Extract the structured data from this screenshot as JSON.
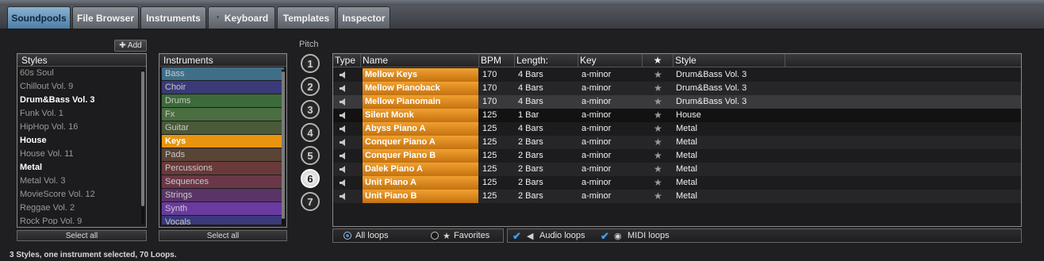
{
  "tabs": [
    {
      "label": "Soundpools",
      "active": true
    },
    {
      "label": "File Browser",
      "active": false
    },
    {
      "label": "Instruments",
      "active": false
    },
    {
      "label": "Keyboard",
      "active": false
    },
    {
      "label": "Templates",
      "active": false
    },
    {
      "label": "Inspector",
      "active": false
    }
  ],
  "add_button": {
    "icon": "plus-icon",
    "label": "Add"
  },
  "styles": {
    "header": "Styles",
    "items": [
      {
        "label": "60s Soul",
        "selected": false
      },
      {
        "label": "Chillout Vol. 9",
        "selected": false
      },
      {
        "label": "Drum&Bass Vol. 3",
        "selected": true
      },
      {
        "label": "Funk Vol. 1",
        "selected": false
      },
      {
        "label": "HipHop Vol. 16",
        "selected": false
      },
      {
        "label": "House",
        "selected": true
      },
      {
        "label": "House Vol. 11",
        "selected": false
      },
      {
        "label": "Metal",
        "selected": true
      },
      {
        "label": "Metal Vol. 3",
        "selected": false
      },
      {
        "label": "MovieScore Vol. 12",
        "selected": false
      },
      {
        "label": "Reggae Vol. 2",
        "selected": false
      },
      {
        "label": "Rock Pop Vol. 9",
        "selected": false
      }
    ],
    "select_all": "Select all"
  },
  "instruments": {
    "header": "Instruments",
    "items": [
      {
        "label": "Bass",
        "color": "#3f6f88",
        "selected": false
      },
      {
        "label": "Choir",
        "color": "#3a3a78",
        "selected": false
      },
      {
        "label": "Drums",
        "color": "#3c6a3a",
        "selected": false
      },
      {
        "label": "Fx",
        "color": "#4a6e40",
        "selected": false
      },
      {
        "label": "Guitar",
        "color": "#4a5a38",
        "selected": false
      },
      {
        "label": "Keys",
        "color": "#e8940e",
        "selected": true
      },
      {
        "label": "Pads",
        "color": "#5a4436",
        "selected": false
      },
      {
        "label": "Percussions",
        "color": "#6a3a3a",
        "selected": false
      },
      {
        "label": "Sequences",
        "color": "#6a3848",
        "selected": false
      },
      {
        "label": "Strings",
        "color": "#5a3466",
        "selected": false
      },
      {
        "label": "Synth",
        "color": "#6a3aa0",
        "selected": false
      },
      {
        "label": "Vocals",
        "color": "#3a3a7a",
        "selected": false
      }
    ],
    "select_all": "Select all"
  },
  "pitch": {
    "title": "Pitch",
    "buttons": [
      "1",
      "2",
      "3",
      "4",
      "5",
      "6",
      "7"
    ],
    "selected": "6"
  },
  "loops": {
    "columns": {
      "type": "Type",
      "name": "Name",
      "bpm": "BPM",
      "length": "Length:",
      "key": "Key",
      "star": "★",
      "style": "Style"
    },
    "rows": [
      {
        "name": "Mellow Keys",
        "bpm": "170",
        "length": "4 Bars",
        "key": "a-minor",
        "style": "Drum&Bass Vol. 3"
      },
      {
        "name": "Mellow Pianoback",
        "bpm": "170",
        "length": "4 Bars",
        "key": "a-minor",
        "style": "Drum&Bass Vol. 3"
      },
      {
        "name": "Mellow Pianomain",
        "bpm": "170",
        "length": "4 Bars",
        "key": "a-minor",
        "style": "Drum&Bass Vol. 3"
      },
      {
        "name": "Silent Monk",
        "bpm": "125",
        "length": "1 Bar",
        "key": "a-minor",
        "style": "House"
      },
      {
        "name": "Abyss Piano A",
        "bpm": "125",
        "length": "4 Bars",
        "key": "a-minor",
        "style": "Metal"
      },
      {
        "name": "Conquer Piano A",
        "bpm": "125",
        "length": "2 Bars",
        "key": "a-minor",
        "style": "Metal"
      },
      {
        "name": "Conquer Piano B",
        "bpm": "125",
        "length": "2 Bars",
        "key": "a-minor",
        "style": "Metal"
      },
      {
        "name": "Dalek Piano A",
        "bpm": "125",
        "length": "2 Bars",
        "key": "a-minor",
        "style": "Metal"
      },
      {
        "name": "Unit Piano A",
        "bpm": "125",
        "length": "2 Bars",
        "key": "a-minor",
        "style": "Metal"
      },
      {
        "name": "Unit Piano B",
        "bpm": "125",
        "length": "2 Bars",
        "key": "a-minor",
        "style": "Metal"
      }
    ]
  },
  "filters": {
    "all_loops": "All loops",
    "favorites": "Favorites",
    "audio_loops": "Audio loops",
    "midi_loops": "MIDI loops"
  },
  "status": "3 Styles, one instrument selected, 70 Loops.",
  "colors": {
    "accent": "#e8940e",
    "active_tab": "#6a98bf",
    "checkbox": "#3c9ef0"
  }
}
